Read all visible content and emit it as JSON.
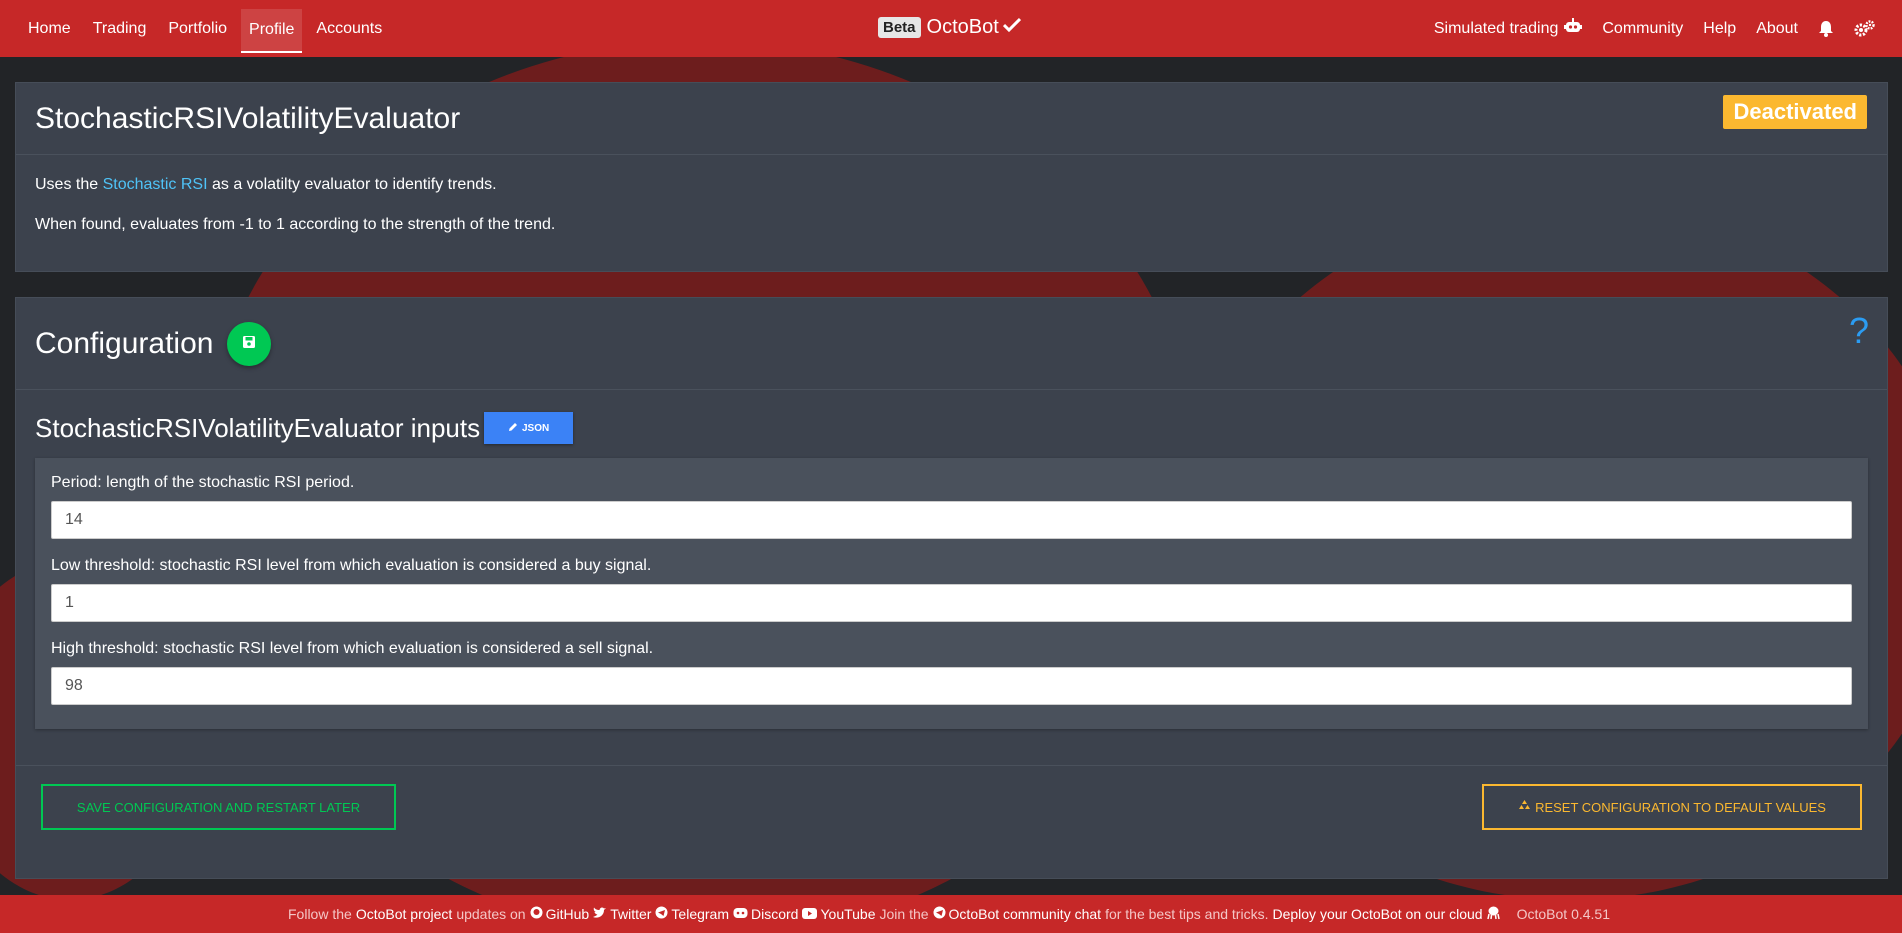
{
  "nav": {
    "left": [
      "Home",
      "Trading",
      "Portfolio",
      "Profile",
      "Accounts"
    ],
    "active": "Profile",
    "beta": "Beta",
    "brand": "OctoBot",
    "right": [
      "Simulated trading",
      "Community",
      "Help",
      "About"
    ]
  },
  "evaluator": {
    "title": "StochasticRSIVolatilityEvaluator",
    "status": "Deactivated",
    "desc_prefix": "Uses the ",
    "desc_link": "Stochastic RSI",
    "desc_suffix": " as a volatilty evaluator to identify trends.",
    "desc_line2": "When found, evaluates from -1 to 1 according to the strength of the trend."
  },
  "config": {
    "title": "Configuration",
    "help": "?",
    "inputs_title": "StochasticRSIVolatilityEvaluator inputs",
    "json_label": "JSON",
    "fields": [
      {
        "label": "Period: length of the stochastic RSI period.",
        "value": "14"
      },
      {
        "label": "Low threshold: stochastic RSI level from which evaluation is considered a buy signal.",
        "value": "1"
      },
      {
        "label": "High threshold: stochastic RSI level from which evaluation is considered a sell signal.",
        "value": "98"
      }
    ],
    "save_label": "SAVE CONFIGURATION AND RESTART LATER",
    "reset_label": "RESET CONFIGURATION TO DEFAULT VALUES"
  },
  "footer": {
    "t1": "Follow the",
    "t2": "OctoBot project",
    "t3": "updates on",
    "github": "GitHub",
    "twitter": "Twitter",
    "telegram": "Telegram",
    "discord": "Discord",
    "youtube": "YouTube",
    "t4": "Join the",
    "chat": "OctoBot community chat",
    "t5": "for the best tips and tricks.",
    "deploy": "Deploy your OctoBot on our cloud",
    "version": "OctoBot 0.4.51"
  },
  "colors": {
    "navbar": "#c62828",
    "panel": "#3c424d",
    "status": "#fbb830",
    "save": "#00c853",
    "json": "#3b82f6"
  }
}
